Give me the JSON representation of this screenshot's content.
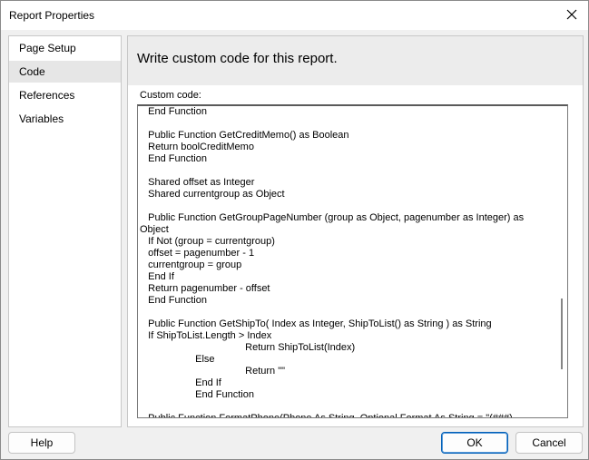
{
  "window": {
    "title": "Report Properties"
  },
  "nav": {
    "items": [
      {
        "label": "Page Setup"
      },
      {
        "label": "Code"
      },
      {
        "label": "References"
      },
      {
        "label": "Variables"
      }
    ],
    "selected": "Code"
  },
  "content": {
    "heading": "Write custom code for this report.",
    "code_label": "Custom code:",
    "code": "   End Function\n\n   Public Function GetCreditMemo() as Boolean\n   Return boolCreditMemo\n   End Function\n\n   Shared offset as Integer\n   Shared currentgroup as Object\n\n   Public Function GetGroupPageNumber (group as Object, pagenumber as Integer) as\nObject\n   If Not (group = currentgroup)\n   offset = pagenumber - 1\n   currentgroup = group\n   End If\n   Return pagenumber - offset\n   End Function\n\n   Public Function GetShipTo( Index as Integer, ShipToList() as String ) as String\n   If ShipToList.Length > Index\n                                      Return ShipToList(Index)\n                    Else\n                                      Return \"\"\n                    End If\n                    End Function\n\n   Public Function FormatPhone(Phone As String, Optional Format As String = \"(###)"
  },
  "buttons": {
    "help": "Help",
    "ok": "OK",
    "cancel": "Cancel"
  },
  "colors": {
    "selected_nav_bg": "#e6e6e6",
    "header_bg": "#ececec",
    "primary_border": "#005fb8"
  }
}
